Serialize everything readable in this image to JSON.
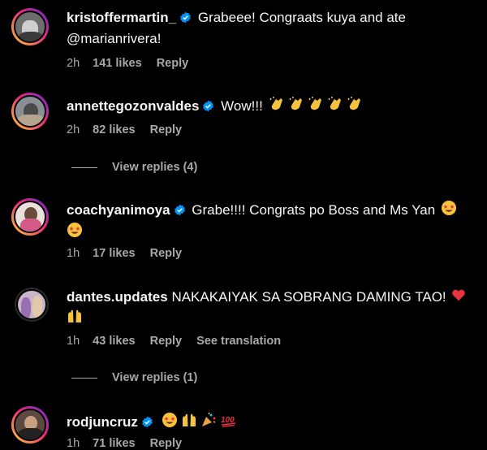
{
  "comments": [
    {
      "username": "kristoffermartin_",
      "text": "Grabeee! Congraats kuya and ate @marianrivera!",
      "time": "2h",
      "likes": "141 likes",
      "reply": "Reply"
    },
    {
      "username": "annettegozonvaldes",
      "text": "Wow!!!",
      "time": "2h",
      "likes": "82 likes",
      "reply": "Reply",
      "view_replies": "View replies (4)"
    },
    {
      "username": "coachyanimoya",
      "text": "Grabe!!!! Congrats po Boss and Ms Yan",
      "time": "1h",
      "likes": "17 likes",
      "reply": "Reply"
    },
    {
      "username": "dantes.updates",
      "text": "NAKAKAIYAK SA SOBRANG DAMING TAO!",
      "time": "1h",
      "likes": "43 likes",
      "reply": "Reply",
      "see_translation": "See translation",
      "view_replies": "View replies (1)"
    },
    {
      "username": "rodjuncruz",
      "text": "",
      "time": "1h",
      "likes": "71 likes",
      "reply": "Reply"
    }
  ],
  "colors": {
    "background": "#000000",
    "text": "#f5f5f5",
    "muted": "#a8a8a8",
    "verified": "#0095f6"
  },
  "icons": [
    "verified-badge-icon",
    "clapping-hands-emoji",
    "star-struck-emoji",
    "red-heart-emoji",
    "raising-hands-emoji",
    "party-popper-emoji",
    "hundred-points-emoji"
  ]
}
